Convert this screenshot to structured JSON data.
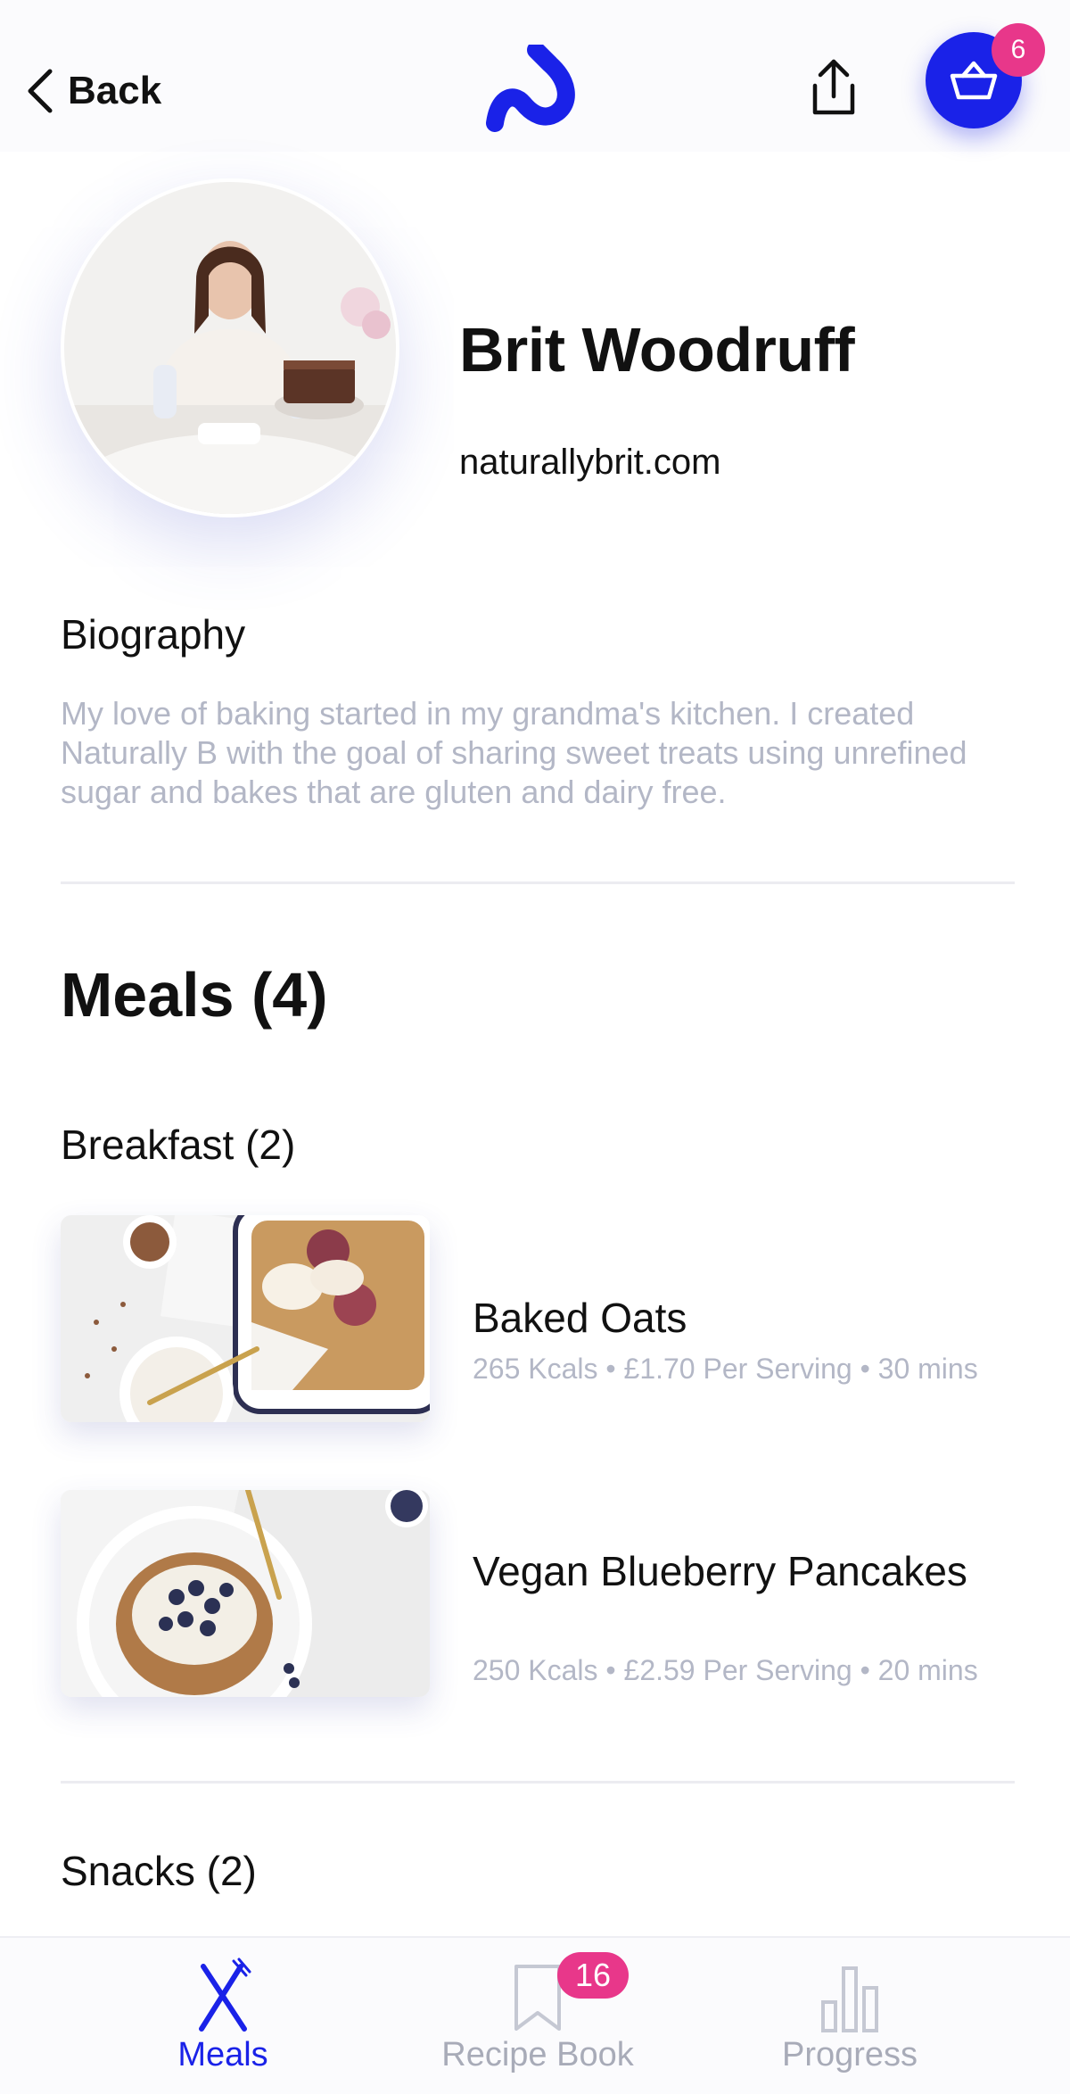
{
  "header": {
    "back_label": "Back",
    "basket_count": "6",
    "brand_color": "#1a22e8",
    "badge_color": "#e8378a"
  },
  "profile": {
    "name": "Brit Woodruff",
    "website": "naturallybrit.com",
    "bio_heading": "Biography",
    "bio_text": "My love of baking started in my grandma's kitchen. I created Naturally B with the goal of sharing sweet treats using unrefined sugar and bakes that are gluten and dairy free."
  },
  "meals": {
    "heading": "Meals (4)",
    "sections": [
      {
        "heading": "Breakfast (2)",
        "items": [
          {
            "title": "Baked Oats",
            "meta": "265 Kcals • £1.70 Per Serving • 30 mins"
          },
          {
            "title": "Vegan Blueberry Pancakes",
            "meta": "250 Kcals • £2.59 Per Serving • 20 mins"
          }
        ]
      },
      {
        "heading": "Snacks (2)",
        "items": []
      }
    ]
  },
  "tabbar": {
    "tabs": [
      {
        "label": "Meals",
        "icon": "fork-knife-icon",
        "active": true
      },
      {
        "label": "Recipe Book",
        "icon": "bookmark-icon",
        "badge": "16"
      },
      {
        "label": "Progress",
        "icon": "bar-chart-icon"
      }
    ]
  }
}
